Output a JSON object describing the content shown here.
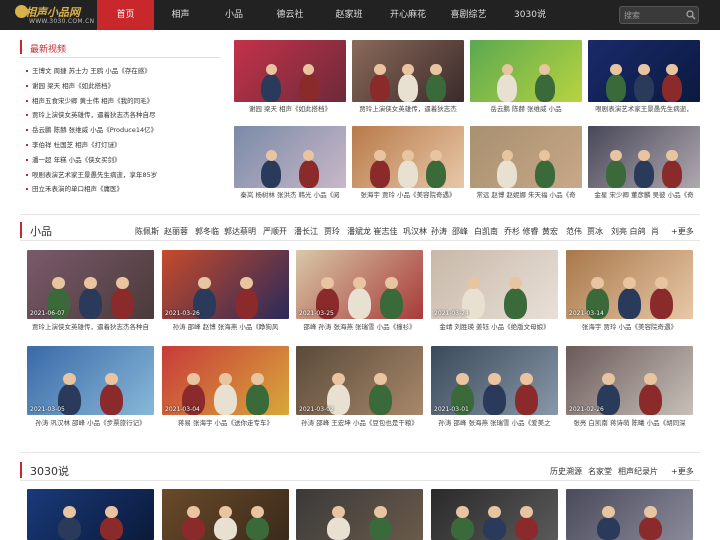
{
  "logo": {
    "main": "相声小品网",
    "sub": "WWW.3030.COM.CN"
  },
  "nav": [
    {
      "label": "首页",
      "active": true
    },
    {
      "label": "相声"
    },
    {
      "label": "小品"
    },
    {
      "label": "德云社"
    },
    {
      "label": "赵家班"
    },
    {
      "label": "开心麻花"
    },
    {
      "label": "喜剧综艺"
    },
    {
      "label": "3030说"
    }
  ],
  "search": {
    "placeholder": "搜索"
  },
  "latest": {
    "title": "最新视频",
    "items": [
      "王博文 周捷 苏士力 王鸥 小品《存在感》",
      "谢园 梁天 相声《如此搭档》",
      "相声五食宋少卿 黄士伟 相声《我的同毛》",
      "贾玲上演侠女英雄传，逼着狄志杰各种自尽",
      "岳云鹏 陈赫 张维威 小品《Produce14亿》",
      "李伯祥 杜国芝 相声《打灯谜》",
      "潘一超 年糕 小品《侠女买剑》",
      "哏剧表演艺术家王景愚先生病逝，享年85岁",
      "田立禾表演的单口相声《庸医》"
    ]
  },
  "top_grid": [
    {
      "caption": "谢园 梁天 相声《如此搭档》",
      "colors": [
        "#c4324a",
        "#6d2a3a"
      ]
    },
    {
      "caption": "贾玲上演侠女英雄传，逼着狄志杰",
      "colors": [
        "#8a6a5a",
        "#3a2a2a"
      ]
    },
    {
      "caption": "岳云鹏 陈赫 张维威 小品",
      "colors": [
        "#5aa850",
        "#b8d440"
      ]
    },
    {
      "caption": "哏剧表演艺术家王景愚先生病逝，",
      "colors": [
        "#1a2a6a",
        "#0a1a40"
      ]
    },
    {
      "caption": "秦岚 杨树林 张洪杰 韩光 小品《阅",
      "colors": [
        "#7a8aa8",
        "#c8b8c8"
      ]
    },
    {
      "caption": "张海宇 贾玲 小品《美容院奇遇》",
      "colors": [
        "#b87a4a",
        "#e8c8a8"
      ]
    },
    {
      "caption": "常远 赵博 赵妮娜 朱天福 小品《奇",
      "colors": [
        "#a89070",
        "#c8a888"
      ]
    },
    {
      "caption": "金星 宋少卿 董彦麟 吴彼 小品《奇",
      "colors": [
        "#484858",
        "#b0a8b0"
      ]
    }
  ],
  "xiaopin": {
    "title": "小品",
    "tags": [
      "陈佩斯",
      "赵丽蓉",
      "郭冬临",
      "郭达蔡明",
      "严顺开",
      "潘长江",
      "贾玲",
      "潘斌龙 崔志佳",
      "巩汉林",
      "孙涛",
      "邵峰",
      "白凯南",
      "乔杉 修睿",
      "黄宏",
      "范伟",
      "贾冰",
      "刘亮 白鸽",
      "肖"
    ],
    "more": "+更多",
    "videos": [
      {
        "caption": "贾玲上演侠女英雄传，逼着狄志杰各种自",
        "date": "2021-06-07",
        "colors": [
          "#7a5a6a",
          "#4a3a3a"
        ]
      },
      {
        "caption": "孙涛 邵峰 赵博 张海燕 小品《睁狗风",
        "date": "2021-03-26",
        "colors": [
          "#c84a2a",
          "#2a2a5a"
        ]
      },
      {
        "caption": "邵峰 孙涛 张海燕 张瑞雪 小品《撞衫》",
        "date": "2021-03-25",
        "colors": [
          "#d8c8a8",
          "#a83a3a"
        ]
      },
      {
        "caption": "金靖 刘胜瑛 姜钰 小品《绝版文母娘》",
        "date": "2021-03-24",
        "colors": [
          "#c8b8a8",
          "#e8e0d8"
        ]
      },
      {
        "caption": "张海宇 贾玲 小品《美容院奇遇》",
        "date": "2021-03-14",
        "colors": [
          "#a8784a",
          "#e8c8a8"
        ]
      },
      {
        "caption": "孙涛 巩汉林 邵峰 小品《步票旅行记》",
        "date": "2021-03-05",
        "colors": [
          "#3a6aa8",
          "#88b8d8"
        ]
      },
      {
        "caption": "蒋易 张海宇 小品《送你走专车》",
        "date": "2021-03-04",
        "colors": [
          "#c83a3a",
          "#d8a83a"
        ]
      },
      {
        "caption": "孙涛 邵峰 王宏坤 小品《豆包也是干粮》",
        "date": "2021-03-02",
        "colors": [
          "#5a4a3a",
          "#a8886a"
        ]
      },
      {
        "caption": "孙涛 邵峰 张海燕 张瑞雪 小品《爱美之",
        "date": "2021-03-01",
        "colors": [
          "#3a4a5a",
          "#8898a8"
        ]
      },
      {
        "caption": "张亮 白凯南 蒋诗萌 陈曦 小品《胡同深",
        "date": "2021-02-26",
        "colors": [
          "#6a5a5a",
          "#c8c0b8"
        ]
      }
    ]
  },
  "sanshi": {
    "title": "3030说",
    "tags": [
      "历史溯源",
      "名家堂",
      "相声纪录片"
    ],
    "more": "+更多",
    "videos": [
      {
        "colors": [
          "#1a3a7a",
          "#0a1a3a"
        ]
      },
      {
        "colors": [
          "#6a4a2a",
          "#3a2a1a"
        ]
      },
      {
        "colors": [
          "#3a3a3a",
          "#6a5a4a"
        ]
      },
      {
        "colors": [
          "#2a2a2a",
          "#5a5a5a"
        ]
      },
      {
        "colors": [
          "#4a4a5a",
          "#8a8a9a"
        ]
      }
    ]
  },
  "colors": {
    "accent": "#c8272c",
    "topbar": "#222222"
  }
}
